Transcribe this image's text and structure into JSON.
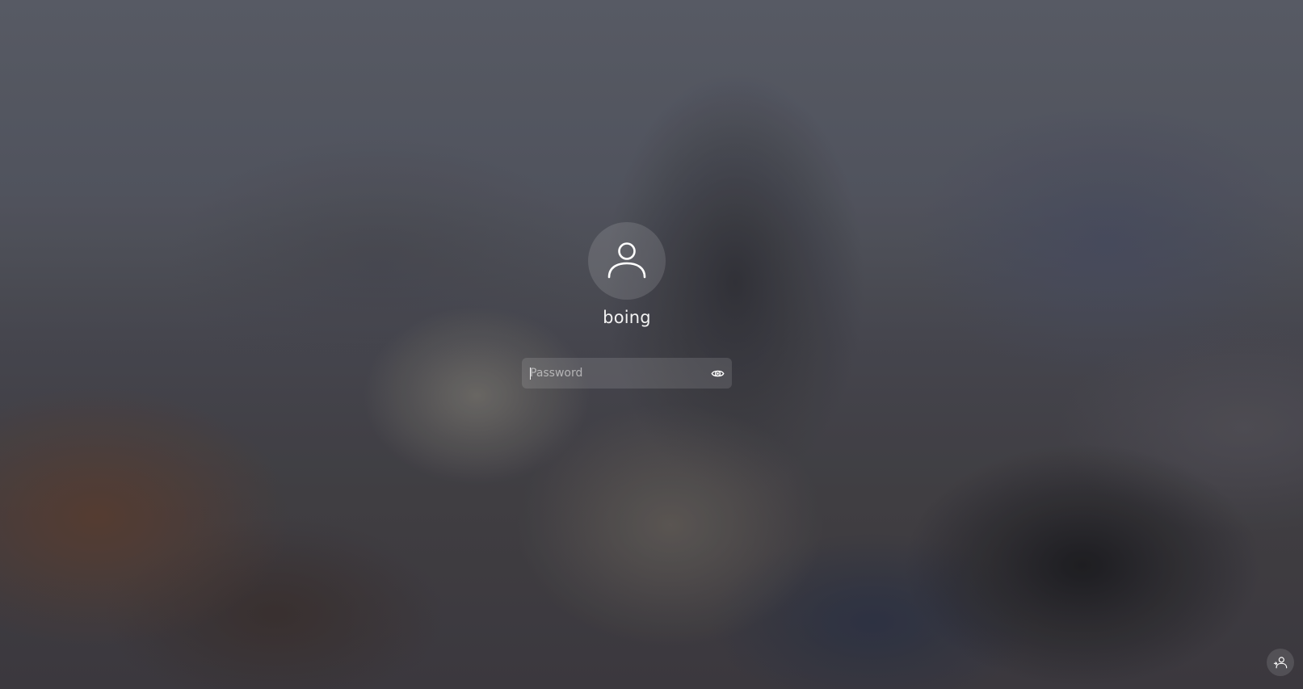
{
  "login": {
    "avatar_icon": "user-icon",
    "username": "boing",
    "password": {
      "value": "",
      "placeholder": "Password",
      "reveal_icon": "eye-icon"
    }
  },
  "corner": {
    "user_switch_icon": "switch-user-icon"
  }
}
